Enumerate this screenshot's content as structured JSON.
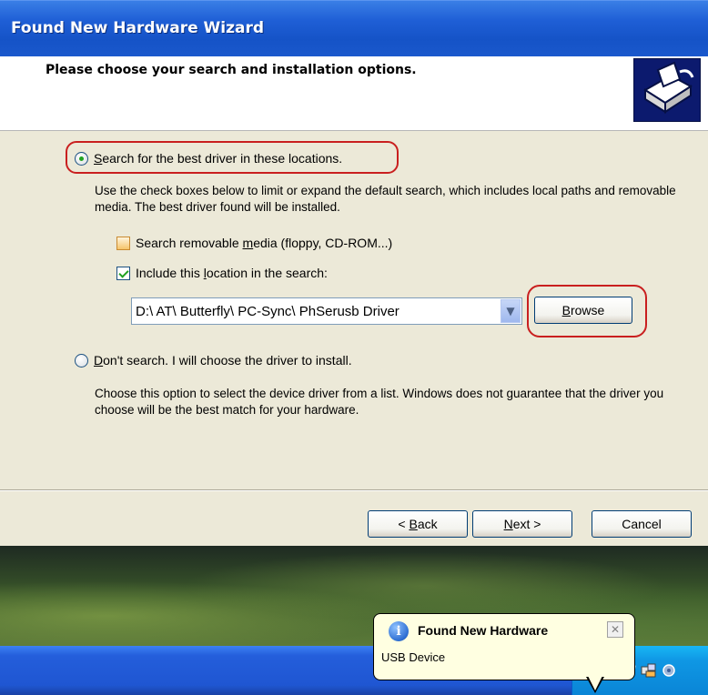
{
  "window": {
    "title": "Found New Hardware Wizard",
    "heading": "Please choose your search and installation options."
  },
  "options": {
    "search": {
      "label_prefix": "",
      "label_key": "S",
      "label_rest": "earch for the best driver in these locations.",
      "selected": true,
      "description": "Use the check boxes below to limit or expand the default search, which includes local paths and removable media. The best driver found will be installed."
    },
    "removable": {
      "label_prefix": "Search removable ",
      "label_key": "m",
      "label_rest": "edia (floppy, CD-ROM...)",
      "checked": false
    },
    "location": {
      "label_prefix": "Include this ",
      "label_key": "l",
      "label_rest": "ocation in the search:",
      "checked": true,
      "path": "D:\\ AT\\ Butterfly\\ PC-Sync\\ PhSerusb Driver"
    },
    "dont_search": {
      "label_prefix": "",
      "label_key": "D",
      "label_rest": "on't search. I will choose the driver to install.",
      "selected": false,
      "description": "Choose this option to select the device driver from a list.  Windows does not guarantee that the driver you choose will be the best match for your hardware."
    }
  },
  "buttons": {
    "browse_key": "B",
    "browse_rest": "rowse",
    "back_prefix": "< ",
    "back_key": "B",
    "back_rest": "ack",
    "next_key": "N",
    "next_rest": "ext >",
    "cancel": "Cancel"
  },
  "balloon": {
    "title": "Found New Hardware",
    "text": "USB Device",
    "info_glyph": "i",
    "close_glyph": "✕"
  },
  "colors": {
    "highlight": "#c91f1f",
    "titlebar": "#1f5fd6",
    "dialog_bg": "#ece9d8",
    "balloon_bg": "#ffffe1"
  },
  "icons": [
    "wizard-hardware-icon",
    "info-icon",
    "close-icon",
    "combo-arrow-icon",
    "network-icon",
    "security-shield-icon",
    "devices-icon",
    "settings-icon"
  ]
}
